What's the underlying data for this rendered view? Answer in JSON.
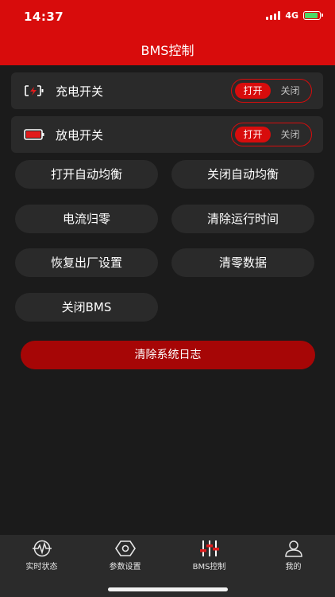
{
  "status_bar": {
    "time": "14:37",
    "network": "4G"
  },
  "header": {
    "title": "BMS控制"
  },
  "charge_switch": {
    "label": "充电开关",
    "on_label": "打开",
    "off_label": "关闭"
  },
  "discharge_switch": {
    "label": "放电开关",
    "on_label": "打开",
    "off_label": "关闭"
  },
  "actions": {
    "enable_balance": "打开自动均衡",
    "disable_balance": "关闭自动均衡",
    "current_zero": "电流归零",
    "clear_runtime": "清除运行时间",
    "factory_reset": "恢复出厂设置",
    "clear_data": "清零数据",
    "close_bms": "关闭BMS"
  },
  "clear_log_button": "清除系统日志",
  "tabs": [
    {
      "label": "实时状态",
      "icon": "heartbeat-icon"
    },
    {
      "label": "参数设置",
      "icon": "hex-nut-icon"
    },
    {
      "label": "BMS控制",
      "icon": "sliders-icon"
    },
    {
      "label": "我的",
      "icon": "person-icon"
    }
  ],
  "colors": {
    "accent": "#d80c0c",
    "button_dark": "#a60606",
    "background": "#1b1b1b",
    "card": "#2a2a2a"
  }
}
